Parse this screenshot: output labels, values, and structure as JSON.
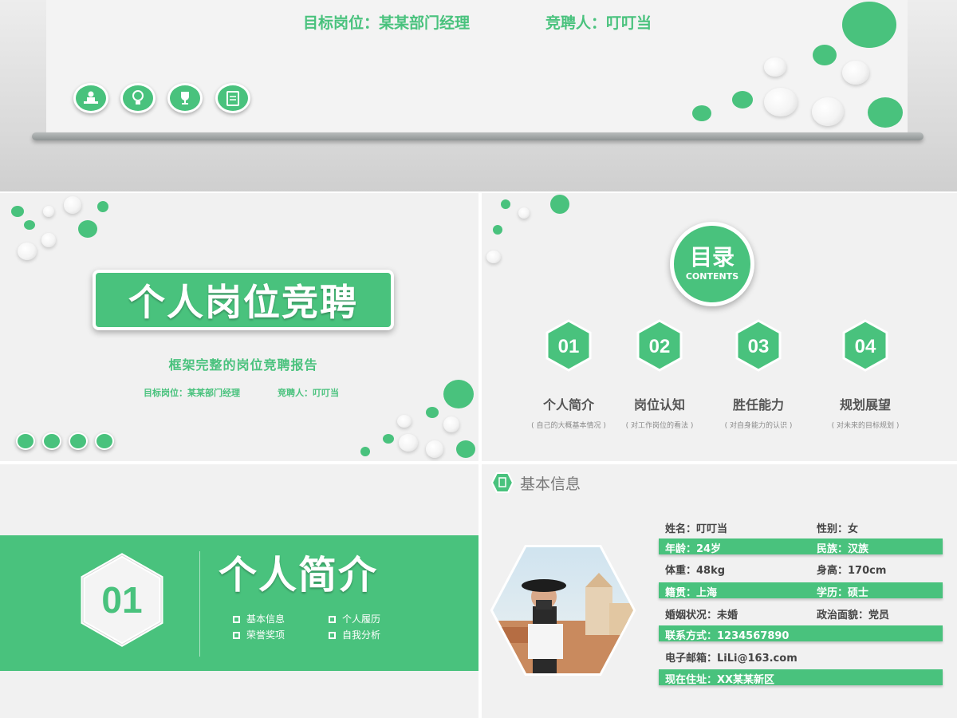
{
  "top": {
    "target_position": "目标岗位：某某部门经理",
    "candidate": "竞聘人：叮叮当",
    "icons": [
      "presenter-icon",
      "lightbulb-icon",
      "trophy-icon",
      "clipboard-icon"
    ]
  },
  "title_slide": {
    "title": "个人岗位竞聘",
    "subtitle": "框架完整的岗位竞聘报告",
    "target_position": "目标岗位：某某部门经理",
    "candidate": "竞聘人：叮叮当"
  },
  "contents": {
    "title": "目录",
    "title_en": "CONTENTS",
    "items": [
      {
        "num": "01",
        "name": "个人简介",
        "desc": "( 自己的大概基本情况 )"
      },
      {
        "num": "02",
        "name": "岗位认知",
        "desc": "( 对工作岗位的看法 )"
      },
      {
        "num": "03",
        "name": "胜任能力",
        "desc": "( 对自身能力的认识 )"
      },
      {
        "num": "04",
        "name": "规划展望",
        "desc": "( 对未来的目标规划 )"
      }
    ]
  },
  "section": {
    "num": "01",
    "title": "个人简介",
    "items": [
      "基本信息",
      "个人履历",
      "荣誉奖项",
      "自我分析"
    ]
  },
  "info": {
    "heading": "基本信息",
    "rows": [
      {
        "c1": "姓名：叮叮当",
        "c2": "性别：女",
        "highlight": false
      },
      {
        "c1": "年龄：24岁",
        "c2": "民族：汉族",
        "highlight": true
      },
      {
        "c1": "体重：48kg",
        "c2": "身高：170cm",
        "highlight": false
      },
      {
        "c1": "籍贯：上海",
        "c2": "学历：硕士",
        "highlight": true
      },
      {
        "c1": "婚姻状况：未婚",
        "c2": "政治面貌：党员",
        "highlight": false
      },
      {
        "c1": "联系方式：1234567890",
        "c2": "",
        "highlight": true
      },
      {
        "c1": "电子邮箱：LiLi@163.com",
        "c2": "",
        "highlight": false
      },
      {
        "c1": "现在住址：XX某某新区",
        "c2": "",
        "highlight": true
      }
    ]
  },
  "colors": {
    "accent": "#49c27d",
    "background": "#f1f1f1"
  }
}
